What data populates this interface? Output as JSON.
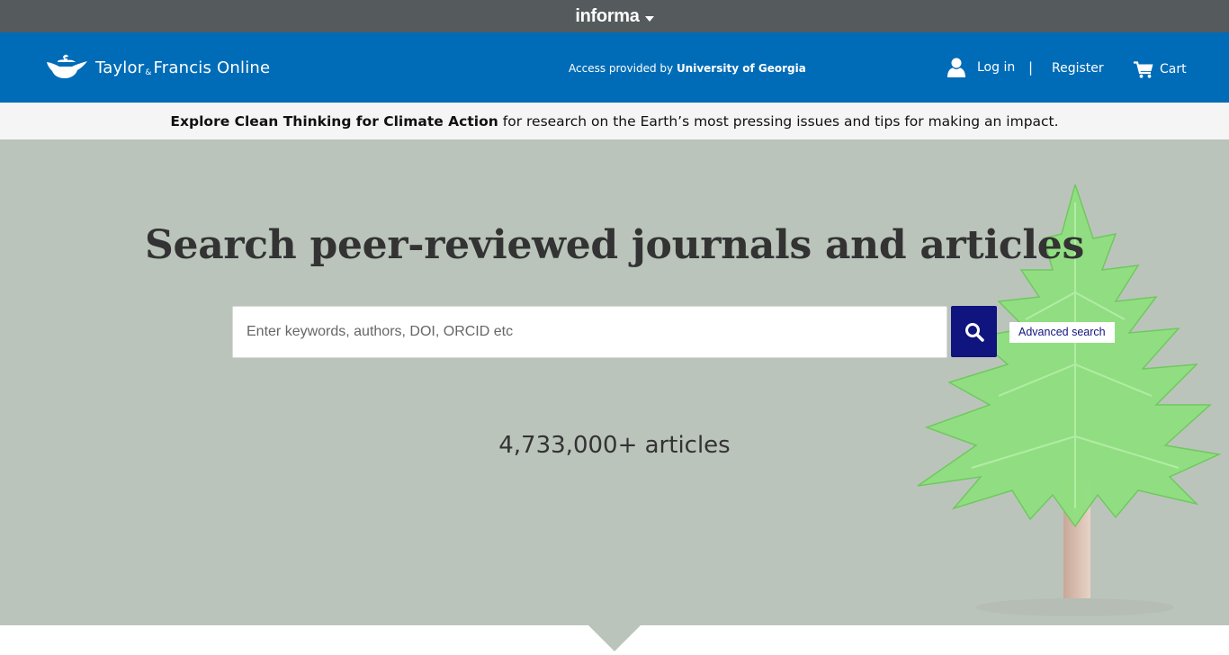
{
  "informa": {
    "logo": "informa",
    "caret_icon": "caret-down-icon"
  },
  "header": {
    "brand": {
      "name_part1": "Taylor",
      "amp": "&",
      "name_part2": "Francis Online",
      "logo_icon": "oil-lamp-icon"
    },
    "access": {
      "prefix": "Access provided by",
      "institution": "University of Georgia"
    },
    "login_label": "Log in",
    "divider": "|",
    "register_label": "Register",
    "cart_label": "Cart"
  },
  "announcement": {
    "link_text": "Explore Clean Thinking for Climate Action",
    "text": "for research on the Earth’s most pressing issues and tips for making an impact."
  },
  "hero": {
    "title": "Search peer-reviewed journals and articles",
    "search": {
      "placeholder": "Enter keywords, authors, DOI, ORCID etc",
      "value": ""
    },
    "advanced_search_label": "Advanced search",
    "article_count": "4,733,000+ articles"
  },
  "colors": {
    "informa_bar": "#555a5d",
    "header": "#006cb7",
    "announcement_bg": "#f5f5f5",
    "hero_bg": "#bbc4bb",
    "search_button": "#10147e",
    "tree": "#7fd86e"
  }
}
